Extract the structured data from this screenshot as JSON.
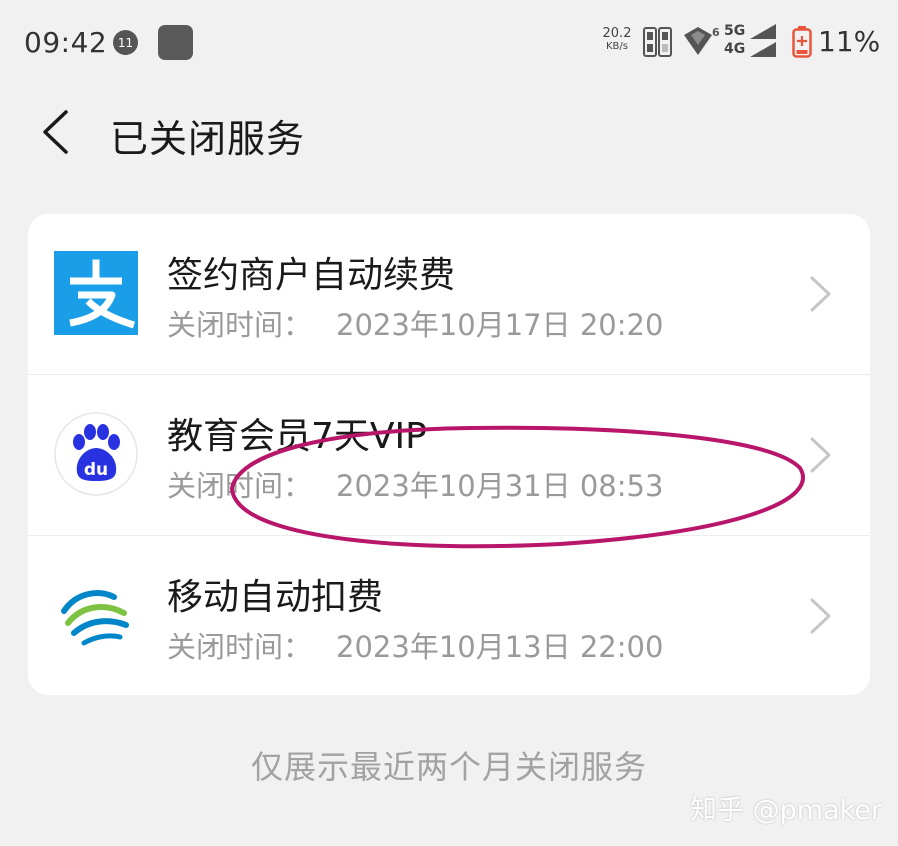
{
  "status_bar": {
    "time": "09:42",
    "notification_count": "11",
    "net_speed_value": "20.2",
    "net_speed_unit": "KB/s",
    "wifi_badge": "6",
    "net_top": "5G",
    "net_bottom": "4G",
    "battery": "11%",
    "battery_color": "#e8553b"
  },
  "header": {
    "title": "已关闭服务"
  },
  "services": [
    {
      "icon": "alipay-icon",
      "title": "签约商户自动续费",
      "label": "关闭时间：",
      "time": "2023年10月17日 20:20",
      "brand_color": "#1a9ee8"
    },
    {
      "icon": "baidu-icon",
      "title": "教育会员7天VIP",
      "label": "关闭时间：",
      "time": "2023年10月31日 08:53",
      "brand_color": "#2932e1",
      "icon_text": "du"
    },
    {
      "icon": "china-mobile-icon",
      "title": "移动自动扣费",
      "label": "关闭时间：",
      "time": "2023年10月13日 22:00",
      "brand_color": "#0086c9"
    }
  ],
  "footer_note": "仅展示最近两个月关闭服务",
  "watermark": "知乎 @pmaker",
  "annotation_color": "#b8166a"
}
